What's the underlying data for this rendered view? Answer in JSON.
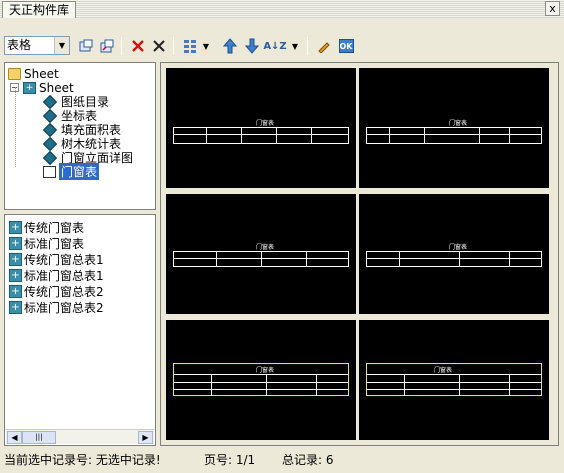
{
  "window": {
    "title": "天正构件库",
    "close_glyph": "x"
  },
  "toolbar": {
    "combo_value": "表格",
    "buttons": [
      "open-icon",
      "saveas-icon",
      "delete-red-icon",
      "delete-icon",
      "view-mode-icon",
      "move-up-icon",
      "move-down-icon",
      "sort-icon",
      "edit-icon",
      "ok-icon"
    ],
    "sort_glyph": "A↓Z",
    "ok_label": "OK"
  },
  "tree": {
    "root": "Sheet",
    "node": "Sheet",
    "children": [
      "图纸目录",
      "坐标表",
      "填充面积表",
      "树木统计表",
      "门窗立面详图",
      "门窗表"
    ],
    "selected_index": 5
  },
  "list": {
    "items": [
      "传统门窗表",
      "标准门窗表",
      "传统门窗总表1",
      "标准门窗总表1",
      "传统门窗总表2",
      "标准门窗总表2"
    ]
  },
  "preview": {
    "thumbnail_titles": [
      "门窗表",
      "门窗表",
      "门窗表",
      "门窗表",
      "门窗表",
      "门窗表"
    ]
  },
  "status": {
    "current_record": "当前选中记录号: 无选中记录!",
    "page": "页号: 1/1",
    "total": "总记录:  6"
  }
}
